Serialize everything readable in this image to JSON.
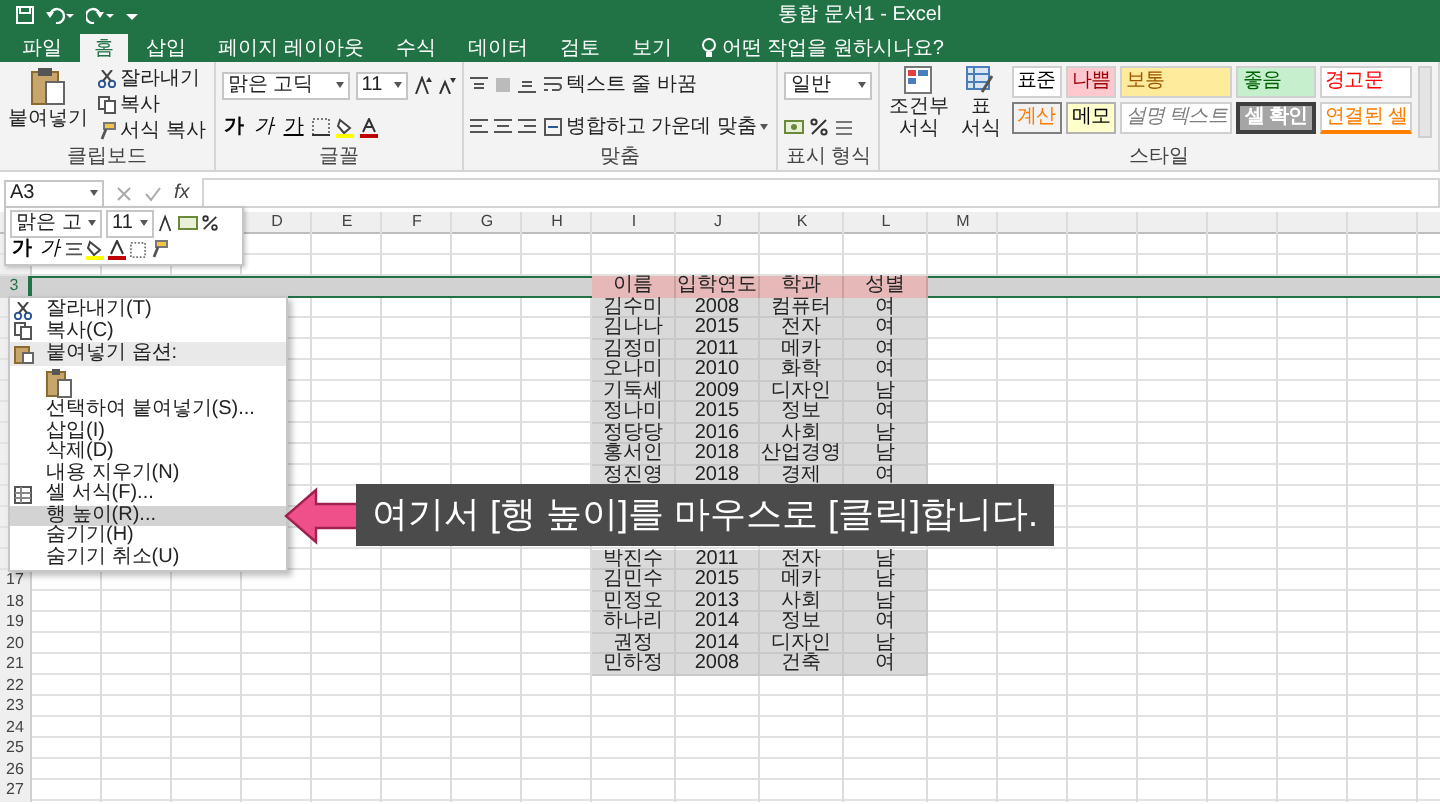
{
  "title_bar": {
    "title": "통합 문서1 - Excel"
  },
  "ribbon": {
    "tabs": [
      {
        "label": "파일",
        "selected": false
      },
      {
        "label": "홈",
        "selected": true
      },
      {
        "label": "삽입",
        "selected": false
      },
      {
        "label": "페이지 레이아웃",
        "selected": false
      },
      {
        "label": "수식",
        "selected": false
      },
      {
        "label": "데이터",
        "selected": false
      },
      {
        "label": "검토",
        "selected": false
      },
      {
        "label": "보기",
        "selected": false
      }
    ],
    "tell_me": {
      "placeholder": "어떤 작업을 원하시나요?"
    },
    "clipboard": {
      "paste": "붙여넣기",
      "cut": "잘라내기",
      "copy": "복사",
      "format_painter": "서식 복사",
      "label": "클립보드"
    },
    "font": {
      "name": "맑은 고딕",
      "size": "11",
      "styles": [
        {
          "label": "가",
          "kind": "bold"
        },
        {
          "label": "가",
          "kind": "italic"
        },
        {
          "label": "가",
          "kind": "underline"
        }
      ],
      "label": "글꼴"
    },
    "alignment": {
      "wrap": "텍스트 줄 바꿈",
      "merge": "병합하고 가운데 맞춤",
      "label": "맞춤"
    },
    "number": {
      "format": "일반",
      "label": "표시 형식"
    },
    "styles": {
      "conditional": "조건부 서식",
      "table": "표 서식",
      "label": "스타일",
      "cells": [
        {
          "label": "표준",
          "kind": "normal"
        },
        {
          "label": "나쁨",
          "kind": "bad"
        },
        {
          "label": "보통",
          "kind": "neutral"
        },
        {
          "label": "좋음",
          "kind": "good"
        },
        {
          "label": "경고문",
          "kind": "warning"
        },
        {
          "label": "계산",
          "kind": "calculation"
        },
        {
          "label": "메모",
          "kind": "note"
        },
        {
          "label": "설명 텍스트",
          "kind": "explanatory"
        },
        {
          "label": "셀 확인",
          "kind": "check"
        },
        {
          "label": "연결된 셀",
          "kind": "linked"
        }
      ]
    }
  },
  "formula_bar": {
    "name_box": "A3",
    "function_label": "fx"
  },
  "sheet": {
    "column_headers": [
      "D",
      "E",
      "F",
      "G",
      "H",
      "I",
      "J",
      "K",
      "L",
      "M"
    ],
    "row_headers": [
      {
        "label": "3",
        "selected": true
      },
      {
        "label": "17",
        "selected": false
      },
      {
        "label": "18",
        "selected": false
      },
      {
        "label": "19",
        "selected": false
      },
      {
        "label": "20",
        "selected": false
      },
      {
        "label": "21",
        "selected": false
      },
      {
        "label": "22",
        "selected": false
      },
      {
        "label": "23",
        "selected": false
      },
      {
        "label": "24",
        "selected": false
      },
      {
        "label": "25",
        "selected": false
      },
      {
        "label": "26",
        "selected": false
      },
      {
        "label": "27",
        "selected": false
      }
    ],
    "table": {
      "header": [
        "이름",
        "입학연도",
        "학과",
        "성별"
      ],
      "rows_above": [
        [
          "김수미",
          "2008",
          "컴퓨터",
          "여"
        ],
        [
          "김나나",
          "2015",
          "전자",
          "여"
        ],
        [
          "김정미",
          "2011",
          "메카",
          "여"
        ],
        [
          "오나미",
          "2010",
          "화학",
          "여"
        ],
        [
          "기둑세",
          "2009",
          "디자인",
          "남"
        ],
        [
          "정나미",
          "2015",
          "정보",
          "여"
        ],
        [
          "정당당",
          "2016",
          "사회",
          "남"
        ],
        [
          "홍서인",
          "2018",
          "산업경영",
          "남"
        ],
        [
          "정진영",
          "2018",
          "경제",
          "여"
        ]
      ],
      "rows_below": [
        [
          "박진수",
          "2011",
          "전자",
          "남"
        ],
        [
          "김민수",
          "2015",
          "메카",
          "남"
        ],
        [
          "민정오",
          "2013",
          "사회",
          "남"
        ],
        [
          "하나리",
          "2014",
          "정보",
          "여"
        ],
        [
          "권정",
          "2014",
          "디자인",
          "남"
        ],
        [
          "민하정",
          "2008",
          "건축",
          "여"
        ]
      ]
    }
  },
  "mini_toolbar": {
    "font": "맑은 고",
    "size": "11",
    "styles": [
      {
        "label": "가",
        "kind": "bold"
      },
      {
        "label": "가",
        "kind": "italic"
      }
    ]
  },
  "context_menu": {
    "items": [
      {
        "label": "잘라내기(T)",
        "kind": "command",
        "selected": false
      },
      {
        "label": "복사(C)",
        "kind": "command",
        "selected": false
      },
      {
        "label": "붙여넣기 옵션:",
        "kind": "heading"
      },
      {
        "kind": "paste-button",
        "selected": false
      },
      {
        "label": "선택하여 붙여넣기(S)...",
        "kind": "command",
        "selected": false
      },
      {
        "label": "삽입(I)",
        "kind": "command",
        "selected": false
      },
      {
        "label": "삭제(D)",
        "kind": "command",
        "selected": false
      },
      {
        "label": "내용 지우기(N)",
        "kind": "command",
        "selected": false
      },
      {
        "label": "셀 서식(F)...",
        "kind": "command",
        "selected": false
      },
      {
        "label": "행 높이(R)...",
        "kind": "command",
        "selected": true
      },
      {
        "label": "숨기기(H)",
        "kind": "command",
        "selected": false
      },
      {
        "label": "숨기기 취소(U)",
        "kind": "command",
        "selected": false
      }
    ]
  },
  "caption": {
    "text": "여기서 [행 높이]를 마우스로 [클릭]합니다."
  }
}
